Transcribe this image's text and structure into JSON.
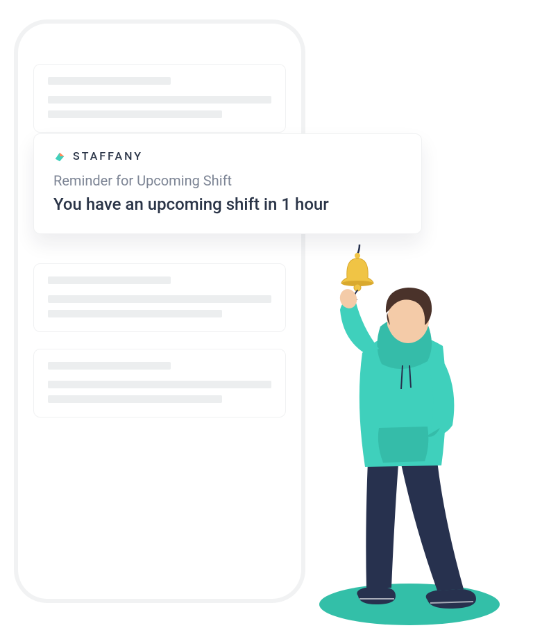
{
  "notification": {
    "brand": "STAFFANY",
    "title": "Reminder for Upcoming Shift",
    "body": "You have an upcoming shift in 1 hour"
  },
  "illustration": {
    "bell_color": "#f0c445",
    "hoodie_color": "#3fd0bc",
    "pants_color": "#27314e",
    "hair_color": "#4a322a",
    "shadow_color": "#33bfa8"
  }
}
